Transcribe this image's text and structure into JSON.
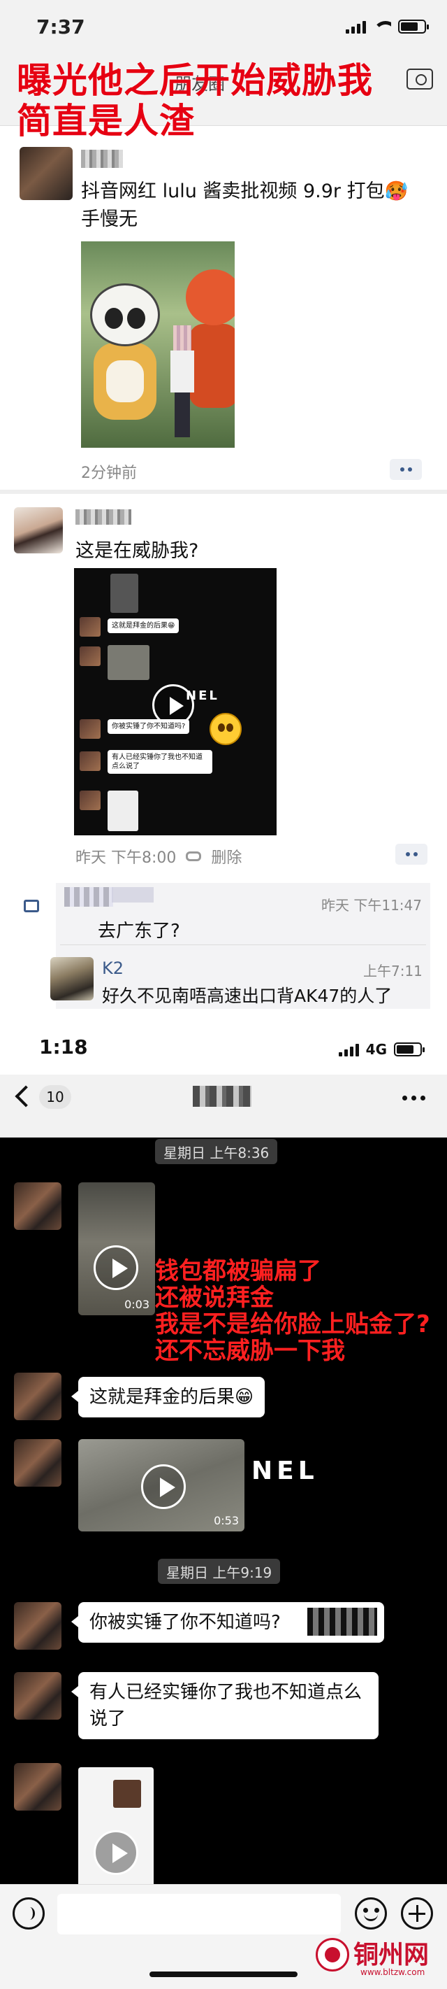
{
  "top_screenshot": {
    "status_time": "7:37",
    "nav_title": "朋友圈",
    "overlay_caption_line1": "曝光他之后开始威胁我",
    "overlay_caption_line2": "简直是人渣",
    "post1": {
      "text": "抖音网红 lulu 酱卖批视频 9.9r 打包🥵手慢无",
      "time": "2分钟前"
    },
    "post2": {
      "text": "这是在威胁我?",
      "time": "昨天 下午8:00",
      "delete_label": "删除",
      "thumbnail": {
        "msg1": "这就是拜金的后果😁",
        "video_brand": "NEL",
        "msg2": "你被实锤了你不知道吗?",
        "msg3": "有人已经实锤你了我也不知道点么说了"
      }
    },
    "comments": [
      {
        "text": "去广东了?",
        "time": "昨天 下午11:47"
      },
      {
        "name": "K2",
        "time": "上午7:11",
        "text": "好久不见南唔高速出口背AK47的人了"
      }
    ]
  },
  "chat_screenshot": {
    "status_time": "1:18",
    "network": "4G",
    "unread_count": "10",
    "time_separator_1": "星期日 上午8:36",
    "time_separator_2": "星期日 上午9:19",
    "video1_duration": "0:03",
    "video2_duration": "0:53",
    "red_overlay": [
      "钱包都被骗扁了",
      "还被说拜金",
      "我是不是给你脸上贴金了?",
      "还不忘威胁一下我"
    ],
    "video2_brand": "NEL",
    "messages": [
      "这就是拜金的后果😁",
      "你被实锤了你不知道吗?",
      "有人已经实锤你了我也不知道点么说了"
    ],
    "input_placeholder": ""
  },
  "watermark": {
    "text": "铜州网",
    "url": "www.bltzw.com",
    "color": "#c8102e"
  },
  "colors": {
    "overlay_red": "#e60012",
    "link_blue": "#3b5a8a",
    "chat_background": "#000000"
  }
}
